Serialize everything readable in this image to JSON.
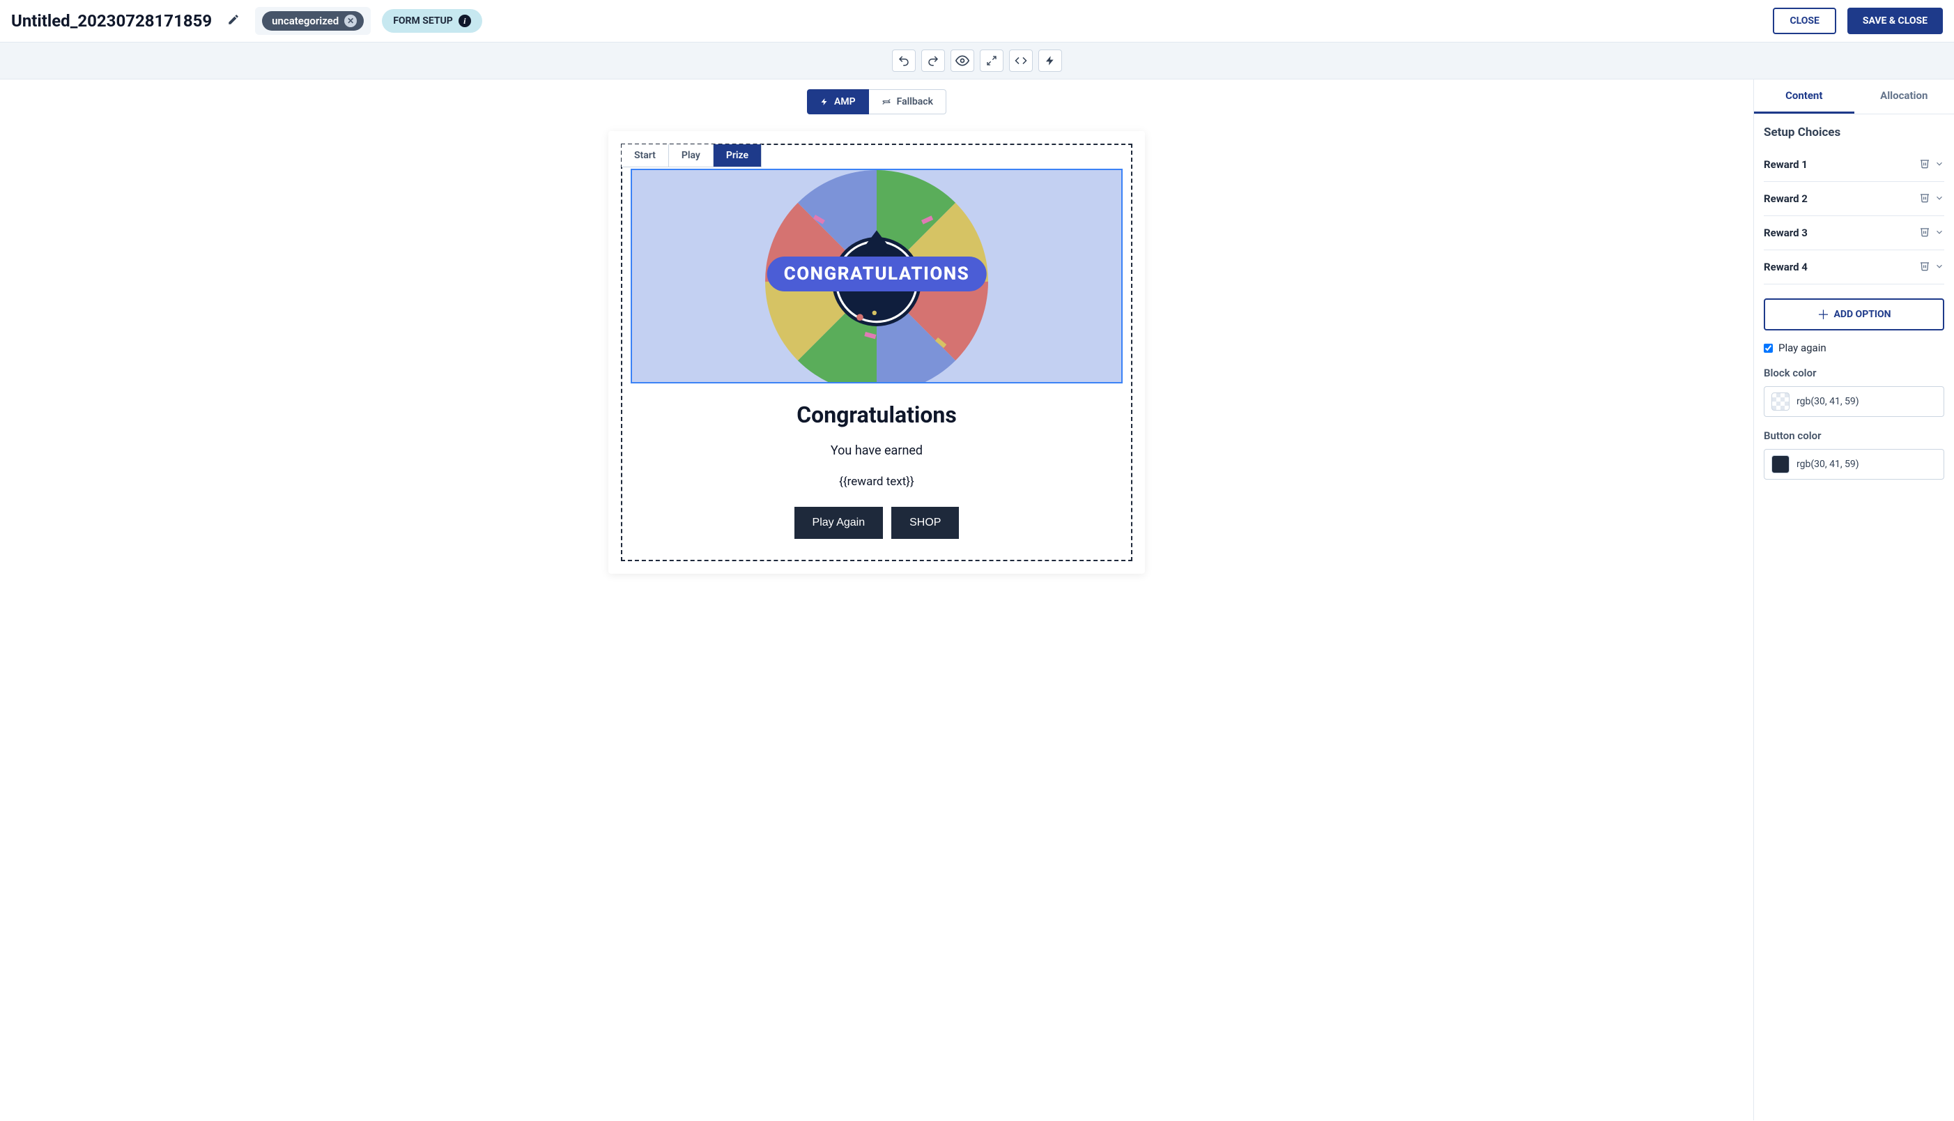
{
  "header": {
    "title": "Untitled_20230728171859",
    "tag": "uncategorized",
    "form_setup": "FORM SETUP",
    "close": "CLOSE",
    "save": "SAVE & CLOSE"
  },
  "segmented": {
    "amp": "AMP",
    "fallback": "Fallback"
  },
  "canvas": {
    "tabs": [
      "Start",
      "Play",
      "Prize"
    ],
    "banner": "CONGRATULATIONS",
    "heading": "Congratulations",
    "subtext": "You have earned",
    "reward_placeholder": "{{reward text}}",
    "play_again": "Play Again",
    "shop": "SHOP"
  },
  "panel": {
    "tabs": {
      "content": "Content",
      "allocation": "Allocation"
    },
    "setup_choices": "Setup Choices",
    "rewards": [
      "Reward 1",
      "Reward 2",
      "Reward 3",
      "Reward 4"
    ],
    "add_option": "ADD OPTION",
    "play_again_check": "Play again",
    "block_color_label": "Block color",
    "block_color": "rgb(30, 41, 59)",
    "button_color_label": "Button color",
    "button_color": "rgb(30, 41, 59)"
  }
}
